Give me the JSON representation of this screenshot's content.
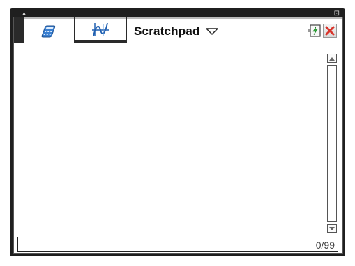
{
  "tabs": [
    {
      "label": "",
      "icon": "calculator-icon"
    },
    {
      "label": "",
      "icon": "graph-icon"
    },
    {
      "label": "Scratchpad",
      "icon": "chevron-down-icon"
    }
  ],
  "status": {
    "battery_icon": "battery-charging-icon",
    "close_icon": "close-icon",
    "close_color": "#d9342b"
  },
  "history": {
    "counter": "0/99"
  }
}
